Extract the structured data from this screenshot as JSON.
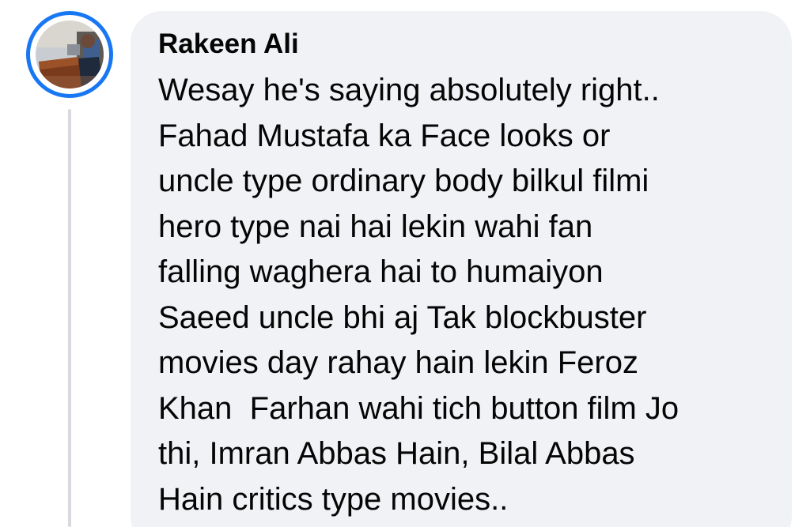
{
  "comment": {
    "author": "Rakeen Ali",
    "lines": [
      "Wesay he's saying absolutely right..",
      "Fahad Mustafa ka Face looks or",
      "uncle type ordinary body bilkul filmi",
      "hero type nai hai lekin wahi fan",
      "falling waghera hai to humaiyon",
      "Saeed uncle bhi aj Tak blockbuster",
      "movies day rahay hain lekin Feroz",
      "Khan  Farhan wahi tich button film Jo",
      "thi, Imran Abbas Hain, Bilal Abbas",
      "Hain critics type movies.."
    ]
  },
  "theme": {
    "accent": "#1877f2",
    "bubble_bg": "#f0f2f5",
    "text": "#050505",
    "thread_line": "#d8dadf"
  }
}
